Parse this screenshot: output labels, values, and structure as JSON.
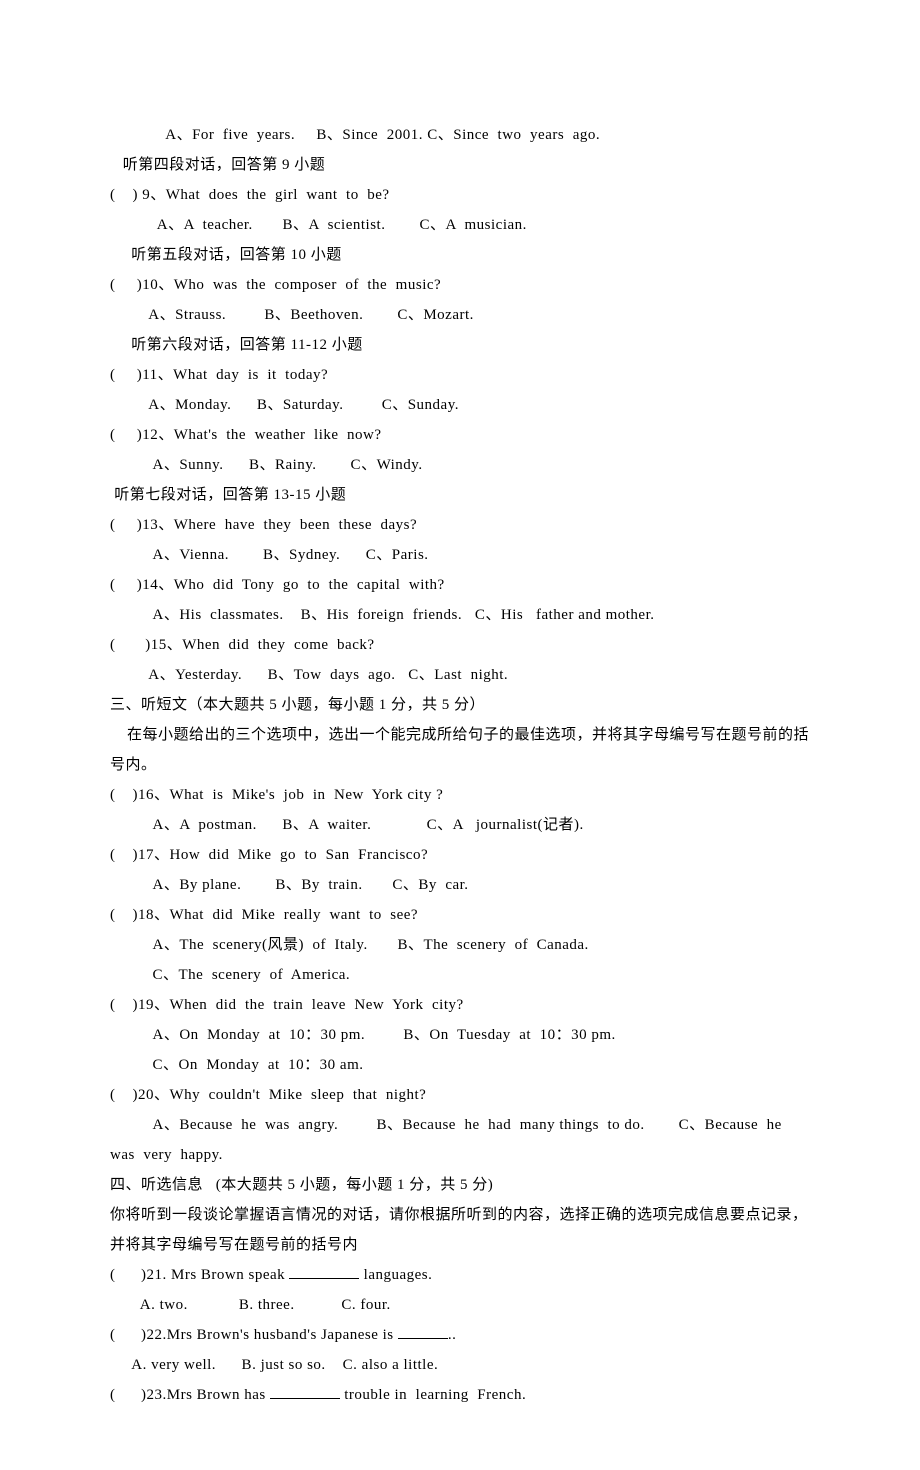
{
  "lines": {
    "l1": "             A、For  five  years.     B、Since  2001. C、Since  two  years  ago.",
    "l2": "   听第四段对话，回答第 9 小题",
    "l3": "(    ) 9、What  does  the  girl  want  to  be?",
    "l4": "           A、A  teacher.       B、A  scientist.        C、A  musician.",
    "l5": "     听第五段对话，回答第 10 小题",
    "l6": "(     )10、Who  was  the  composer  of  the  music?",
    "l7": "         A、Strauss.         B、Beethoven.        C、Mozart.",
    "l8": "     听第六段对话，回答第 11-12 小题",
    "l9": "(     )11、What  day  is  it  today?",
    "l10": "         A、Monday.      B、Saturday.         C、Sunday.",
    "l11": "(     )12、What's  the  weather  like  now?",
    "l12": "          A、Sunny.      B、Rainy.        C、Windy.",
    "l13": " 听第七段对话，回答第 13-15 小题",
    "l14": "(     )13、Where  have  they  been  these  days?",
    "l15": "          A、Vienna.        B、Sydney.      C、Paris.",
    "l16": "(     )14、Who  did  Tony  go  to  the  capital  with?",
    "l17": "          A、His  classmates.    B、His  foreign  friends.   C、His   father and mother.",
    "l18": "(       )15、When  did  they  come  back?",
    "l19": "         A、Yesterday.      B、Tow  days  ago.   C、Last  night.",
    "l20": "三、听短文（本大题共 5 小题，每小题 1 分，共 5 分）",
    "l21": "    在每小题给出的三个选项中，选出一个能完成所给句子的最佳选项，并将其字母编号写在题号前的括号内。",
    "l22": "(    )16、What  is  Mike's  job  in  New  York city ?",
    "l23": "          A、A  postman.      B、A  waiter.             C、A   journalist(记者).",
    "l24": "(    )17、How  did  Mike  go  to  San  Francisco?",
    "l25": "          A、By plane.        B、By  train.       C、By  car.",
    "l26": "(    )18、What  did  Mike  really  want  to  see?",
    "l27": "          A、The  scenery(风景)  of  Italy.       B、The  scenery  of  Canada.",
    "l28": "          C、The  scenery  of  America.",
    "l29": "(    )19、When  did  the  train  leave  New  York  city?",
    "l30": "          A、On  Monday  at  10：30 pm.         B、On  Tuesday  at  10：30 pm.",
    "l31": "          C、On  Monday  at  10：30 am.",
    "l32": "(    )20、Why  couldn't  Mike  sleep  that  night?",
    "l33": "          A、Because  he  was  angry.         B、Because  he  had  many things  to do.        C、Because  he  was  very  happy.",
    "l34": "四、听选信息   (本大题共 5 小题，每小题 1 分，共 5 分)",
    "l35": "你将听到一段谈论掌握语言情况的对话，请你根据所听到的内容，选择正确的选项完成信息要点记录，并将其字母编号写在题号前的括号内",
    "q21a": "(      )21. Mrs Brown speak ",
    "q21b": " languages.",
    "l37": "       A. two.            B. three.           C. four.",
    "q22a": "(      )22.Mrs Brown's husband's Japanese is ",
    "q22b": "..",
    "l39": "     A. very well.      B. just so so.    C. also a little.",
    "q23a": "(      )23.Mrs Brown has ",
    "q23b": " trouble in  learning  French."
  }
}
